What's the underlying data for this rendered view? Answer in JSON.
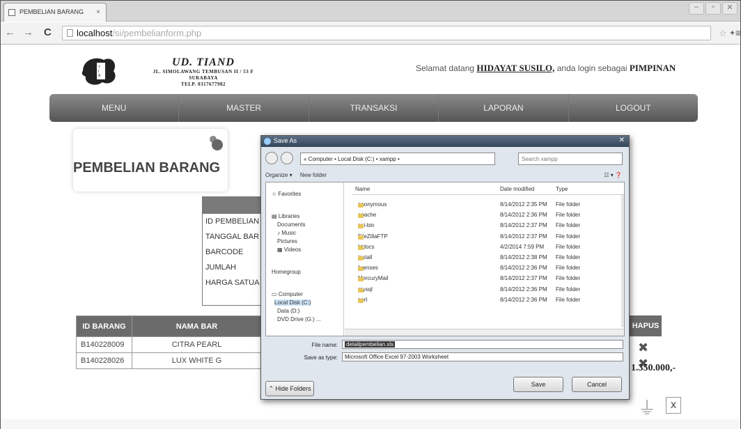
{
  "browser": {
    "tab_title": "PEMBELIAN BARANG",
    "url_host": "localhost",
    "url_path": "/si/pembelianform.php"
  },
  "header": {
    "company_name": "UD. TIAND",
    "address_line1": "JL. SIMOLAWANG TEMBUSAN II / 53 F",
    "address_line2": "SURABAYA",
    "address_line3": "TELP. 0317677982",
    "welcome_prefix": "Selamat datang",
    "user_name": "HIDAYAT SUSILO,",
    "welcome_mid": "anda login sebagai",
    "role": "PIMPINAN"
  },
  "nav": [
    "MENU",
    "MASTER",
    "TRANSAKSI",
    "LAPORAN",
    "LOGOUT"
  ],
  "page_title": "PEMBELIAN BARANG",
  "form_labels": [
    "ID PEMBELIAN",
    "TANGGAL BAR",
    "BARCODE",
    "JUMLAH",
    "HARGA SATUA"
  ],
  "table": {
    "headers": [
      "ID BARANG",
      "NAMA BAR"
    ],
    "hapus_header": "HAPUS",
    "rows": [
      {
        "id": "B140228009",
        "nama": "CITRA PEARL"
      },
      {
        "id": "B140228026",
        "nama": "LUX WHITE G"
      }
    ],
    "total": "1.350.000,-"
  },
  "dialog": {
    "title": "Save As",
    "path": "« Computer  •  Local Disk (C:)  •  xampp  •",
    "search_placeholder": "Search xampp",
    "organize": "Organize ▾",
    "new_folder": "New folder",
    "sidebar": [
      "Favorites",
      "Libraries",
      "Documents",
      "Music",
      "Pictures",
      "Videos",
      "Homegroup",
      "Computer",
      "Local Disk (C:)",
      "Data (D:)",
      "DVD Drive (G:) ..."
    ],
    "col_name": "Name",
    "col_date": "Date modified",
    "col_type": "Type",
    "files": [
      {
        "name": "anonymous",
        "date": "8/14/2012 2:35 PM",
        "type": "File folder"
      },
      {
        "name": "apache",
        "date": "8/14/2012 2:36 PM",
        "type": "File folder"
      },
      {
        "name": "cgi-bin",
        "date": "8/14/2012 2:37 PM",
        "type": "File folder"
      },
      {
        "name": "FileZillaFTP",
        "date": "8/14/2012 2:37 PM",
        "type": "File folder"
      },
      {
        "name": "htdocs",
        "date": "4/2/2014 7:59 PM",
        "type": "File folder"
      },
      {
        "name": "install",
        "date": "8/14/2012 2:38 PM",
        "type": "File folder"
      },
      {
        "name": "licenses",
        "date": "8/14/2012 2:36 PM",
        "type": "File folder"
      },
      {
        "name": "MercuryMail",
        "date": "8/14/2012 2:37 PM",
        "type": "File folder"
      },
      {
        "name": "mysql",
        "date": "8/14/2012 2:36 PM",
        "type": "File folder"
      },
      {
        "name": "perl",
        "date": "8/14/2012 2:36 PM",
        "type": "File folder"
      }
    ],
    "file_name_label": "File name:",
    "file_name_value": "detailpembelian.xls",
    "save_type_label": "Save as type:",
    "save_type_value": "Microsoft Office Excel 97-2003 Worksheet",
    "hide_folders": "Hide Folders",
    "save": "Save",
    "cancel": "Cancel"
  },
  "icons": {
    "pdf": "pdf-icon",
    "excel": "excel-icon",
    "delete": "delete-icon"
  }
}
